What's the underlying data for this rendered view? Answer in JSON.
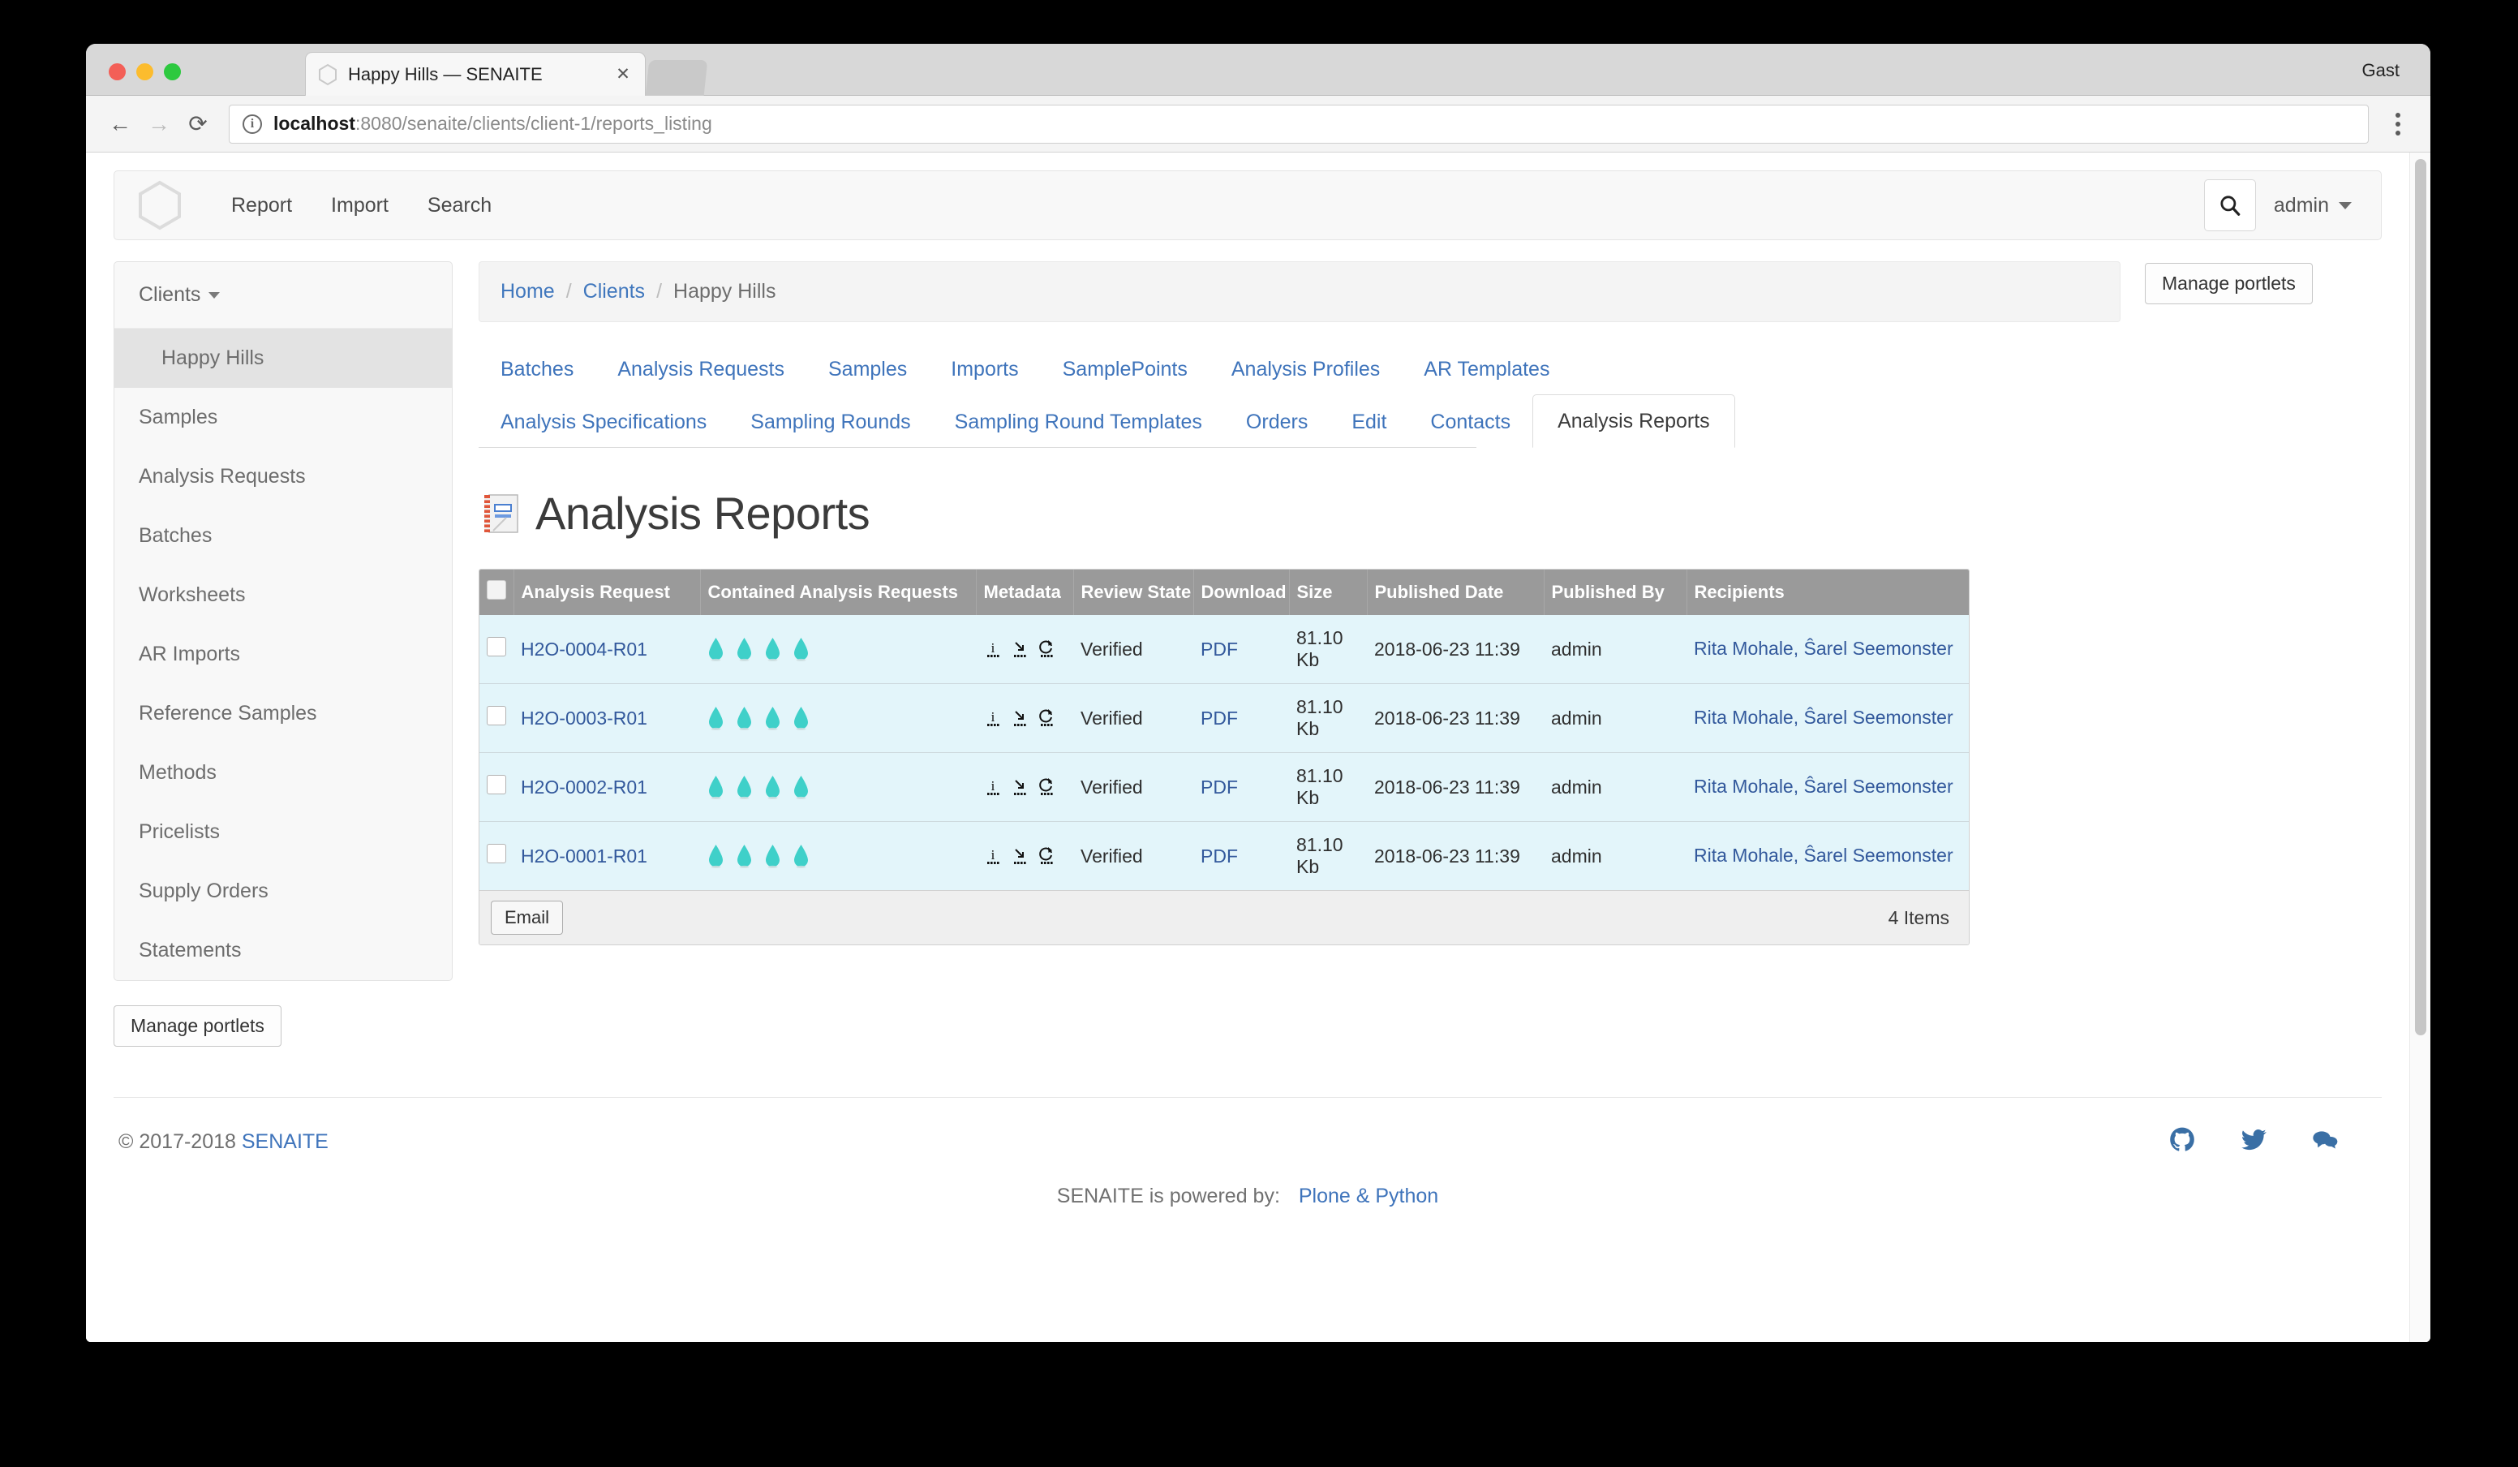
{
  "browser": {
    "tab_title": "Happy Hills — SENAITE",
    "tab_close_label": "✕",
    "profile_name": "Gast",
    "back_glyph": "←",
    "forward_glyph": "→",
    "reload_glyph": "⟳",
    "info_glyph": "i",
    "url_host": "localhost",
    "url_rest": ":8080/senaite/clients/client-1/reports_listing"
  },
  "appnav": {
    "logo_name": "senaite-hexagon-logo",
    "links": [
      {
        "label": "Report"
      },
      {
        "label": "Import"
      },
      {
        "label": "Search"
      }
    ],
    "search_icon": "search-icon",
    "user": "admin"
  },
  "sidebar": {
    "portlet_title": "Clients",
    "items": [
      {
        "label": "Happy Hills",
        "sub": true,
        "active": true
      },
      {
        "label": "Samples",
        "sub": false,
        "active": false
      },
      {
        "label": "Analysis Requests",
        "sub": false,
        "active": false
      },
      {
        "label": "Batches",
        "sub": false,
        "active": false
      },
      {
        "label": "Worksheets",
        "sub": false,
        "active": false
      },
      {
        "label": "AR Imports",
        "sub": false,
        "active": false
      },
      {
        "label": "Reference Samples",
        "sub": false,
        "active": false
      },
      {
        "label": "Methods",
        "sub": false,
        "active": false
      },
      {
        "label": "Pricelists",
        "sub": false,
        "active": false
      },
      {
        "label": "Supply Orders",
        "sub": false,
        "active": false
      },
      {
        "label": "Statements",
        "sub": false,
        "active": false
      }
    ],
    "manage_portlets_label": "Manage portlets"
  },
  "breadcrumb": {
    "home": "Home",
    "sep": "/",
    "clients": "Clients",
    "current": "Happy Hills"
  },
  "tabs": {
    "row1": [
      {
        "label": "Batches",
        "active": false
      },
      {
        "label": "Analysis Requests",
        "active": false
      },
      {
        "label": "Samples",
        "active": false
      },
      {
        "label": "Imports",
        "active": false
      },
      {
        "label": "SamplePoints",
        "active": false
      },
      {
        "label": "Analysis Profiles",
        "active": false
      },
      {
        "label": "AR Templates",
        "active": false
      }
    ],
    "row2": [
      {
        "label": "Analysis Specifications",
        "active": false
      },
      {
        "label": "Sampling Rounds",
        "active": false
      },
      {
        "label": "Sampling Round Templates",
        "active": false
      },
      {
        "label": "Orders",
        "active": false
      },
      {
        "label": "Edit",
        "active": false
      },
      {
        "label": "Contacts",
        "active": false
      },
      {
        "label": "Analysis Reports",
        "active": true
      }
    ]
  },
  "page": {
    "title": "Analysis Reports",
    "title_icon": "report-notebook-icon"
  },
  "table": {
    "columns": [
      "Analysis Request",
      "Contained Analysis Requests",
      "Metadata",
      "Review State",
      "Download",
      "Size",
      "Published Date",
      "Published By",
      "Recipients"
    ],
    "rows": [
      {
        "analysis_request": "H2O-0004-R01",
        "contained_count": 4,
        "metadata_icons": [
          "info-icon",
          "download-icon",
          "reload-icon"
        ],
        "review_state": "Verified",
        "download": "PDF",
        "size": "81.10 Kb",
        "published_date": "2018-06-23 11:39",
        "published_by": "admin",
        "recipients": "Rita Mohale, Ŝarel Seemonster"
      },
      {
        "analysis_request": "H2O-0003-R01",
        "contained_count": 4,
        "metadata_icons": [
          "info-icon",
          "download-icon",
          "reload-icon"
        ],
        "review_state": "Verified",
        "download": "PDF",
        "size": "81.10 Kb",
        "published_date": "2018-06-23 11:39",
        "published_by": "admin",
        "recipients": "Rita Mohale, Ŝarel Seemonster"
      },
      {
        "analysis_request": "H2O-0002-R01",
        "contained_count": 4,
        "metadata_icons": [
          "info-icon",
          "download-icon",
          "reload-icon"
        ],
        "review_state": "Verified",
        "download": "PDF",
        "size": "81.10 Kb",
        "published_date": "2018-06-23 11:39",
        "published_by": "admin",
        "recipients": "Rita Mohale, Ŝarel Seemonster"
      },
      {
        "analysis_request": "H2O-0001-R01",
        "contained_count": 4,
        "metadata_icons": [
          "info-icon",
          "download-icon",
          "reload-icon"
        ],
        "review_state": "Verified",
        "download": "PDF",
        "size": "81.10 Kb",
        "published_date": "2018-06-23 11:39",
        "published_by": "admin",
        "recipients": "Rita Mohale, Ŝarel Seemonster"
      }
    ],
    "email_button": "Email",
    "item_count": "4 Items"
  },
  "right": {
    "manage_portlets_label": "Manage portlets"
  },
  "footer": {
    "copyright_prefix": "© 2017-2018",
    "brand": "SENAITE",
    "social": [
      "github-icon",
      "twitter-icon",
      "chat-icon"
    ],
    "powered_label": "SENAITE is powered by:",
    "powered_link": "Plone & Python"
  },
  "colors": {
    "link": "#3f74bb",
    "table_row": "#e3f5fa",
    "table_header": "#9a9a9a",
    "drop": "#3fd0c9"
  }
}
